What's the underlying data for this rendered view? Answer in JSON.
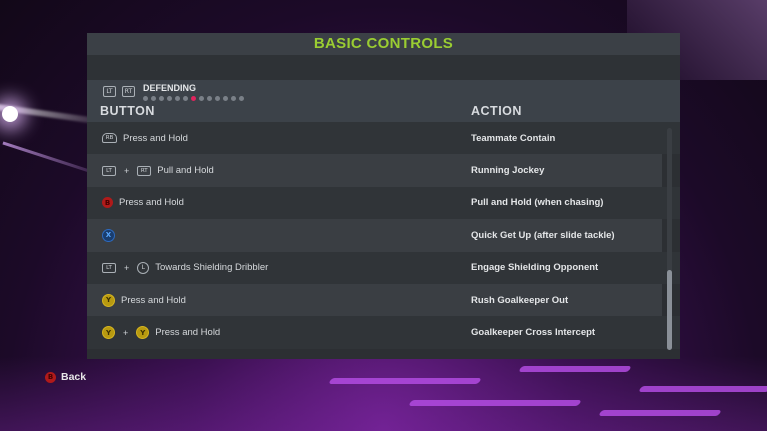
{
  "title": "BASIC CONTROLS",
  "section": {
    "name": "DEFENDING",
    "prev_icon": "LT",
    "next_icon": "RT",
    "page_count": 13,
    "active_page": 6
  },
  "columns": {
    "button": "BUTTON",
    "action": "ACTION"
  },
  "rows": [
    {
      "icons": [
        {
          "type": "bumper",
          "label": "RB"
        }
      ],
      "input": "Press and Hold",
      "action": "Teammate Contain"
    },
    {
      "icons": [
        {
          "type": "rect",
          "label": "LT"
        },
        {
          "type": "rect",
          "label": "RT"
        }
      ],
      "input": "Pull and Hold",
      "action": "Running Jockey"
    },
    {
      "icons": [
        {
          "type": "b",
          "label": "B"
        }
      ],
      "input": "Press and Hold",
      "action": "Pull and Hold (when chasing)"
    },
    {
      "icons": [
        {
          "type": "x",
          "label": "X"
        }
      ],
      "input": "",
      "action": "Quick Get Up (after slide tackle)"
    },
    {
      "icons": [
        {
          "type": "rect",
          "label": "LT"
        },
        {
          "type": "stick",
          "label": "L"
        }
      ],
      "input": "Towards Shielding Dribbler",
      "action": "Engage Shielding Opponent"
    },
    {
      "icons": [
        {
          "type": "y",
          "label": "Y"
        }
      ],
      "input": "Press and Hold",
      "action": "Rush Goalkeeper Out"
    },
    {
      "icons": [
        {
          "type": "y",
          "label": "Y"
        },
        {
          "type": "y",
          "label": "Y"
        }
      ],
      "input": "Press and Hold",
      "action": "Goalkeeper Cross Intercept"
    }
  ],
  "footer": {
    "back_icon": "B",
    "back_label": "Back"
  },
  "colors": {
    "title": "#9acd32",
    "active_dot": "#e0245e",
    "panel": "#2c2f33"
  }
}
